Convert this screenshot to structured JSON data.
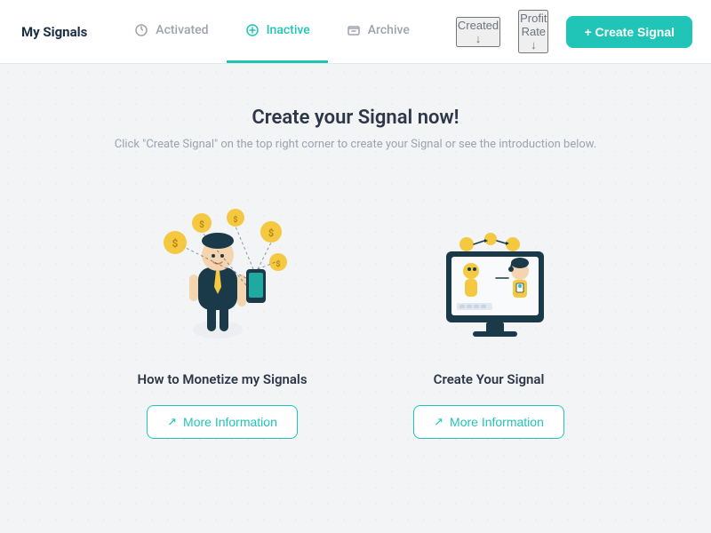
{
  "header": {
    "logo": "My Signals",
    "tabs": [
      {
        "id": "activated",
        "label": "Activated",
        "active": false,
        "icon": "refresh-icon"
      },
      {
        "id": "inactive",
        "label": "Inactive",
        "active": true,
        "icon": "inactive-icon"
      },
      {
        "id": "archive",
        "label": "Archive",
        "active": false,
        "icon": "archive-icon"
      }
    ],
    "sort_created": "Created ↓",
    "sort_profit": "Profit Rate ↓",
    "create_btn": "+ Create Signal"
  },
  "main": {
    "title": "Create your Signal now!",
    "subtitle": "Click \"Create Signal\" on the top right corner to create your Signal or see the introduction below.",
    "cards": [
      {
        "id": "monetize",
        "label": "How to Monetize my Signals",
        "btn_label": "More Information"
      },
      {
        "id": "create",
        "label": "Create Your Signal",
        "btn_label": "More Information"
      }
    ]
  }
}
